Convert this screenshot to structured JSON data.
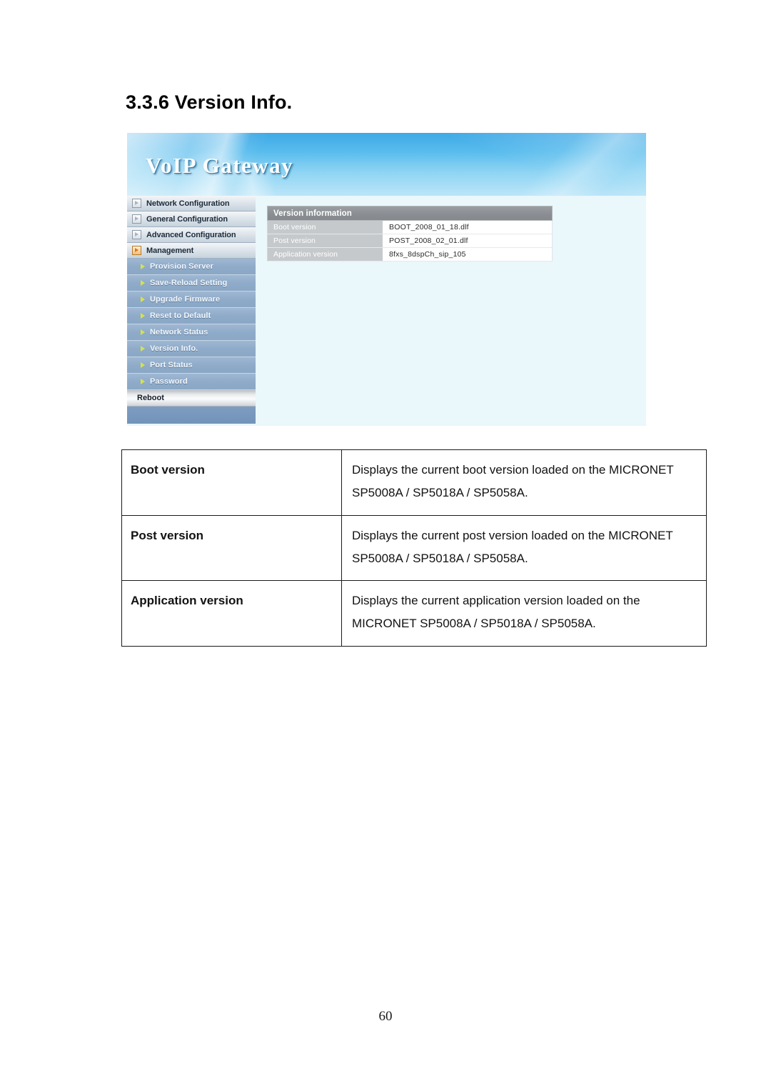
{
  "document": {
    "section_heading": "3.3.6 Version Info.",
    "page_number": "60"
  },
  "screenshot": {
    "banner_title": "VoIP Gateway",
    "sidebar": {
      "top_items": [
        {
          "label": "Network Configuration",
          "icon": "triangle-box-icon",
          "active": false
        },
        {
          "label": "General Configuration",
          "icon": "triangle-box-icon",
          "active": false
        },
        {
          "label": "Advanced Configuration",
          "icon": "triangle-box-icon",
          "active": false
        },
        {
          "label": "Management",
          "icon": "triangle-box-icon",
          "active": true
        }
      ],
      "sub_items": [
        {
          "label": "Provision Server",
          "icon": "arrow-right-icon"
        },
        {
          "label": "Save-Reload Setting",
          "icon": "arrow-right-icon"
        },
        {
          "label": "Upgrade Firmware",
          "icon": "arrow-right-icon"
        },
        {
          "label": "Reset to Default",
          "icon": "arrow-right-icon"
        },
        {
          "label": "Network Status",
          "icon": "arrow-right-icon"
        },
        {
          "label": "Version Info.",
          "icon": "arrow-right-icon"
        },
        {
          "label": "Port Status",
          "icon": "arrow-right-icon"
        },
        {
          "label": "Password",
          "icon": "arrow-right-icon"
        }
      ],
      "reboot_label": "Reboot"
    },
    "version_panel": {
      "title": "Version information",
      "rows": [
        {
          "label": "Boot version",
          "value": "BOOT_2008_01_18.dlf"
        },
        {
          "label": "Post version",
          "value": "POST_2008_02_01.dlf"
        },
        {
          "label": "Application version",
          "value": "8fxs_8dspCh_sip_105"
        }
      ]
    },
    "colors": {
      "banner_blue": "#59bced",
      "panel_background": "#eaf7fb",
      "panel_header_gray": "#8b8e92",
      "label_cell_gray": "#c6c9cc",
      "sub_item_blue": "#8fabc9",
      "sub_item_arrow_green": "#d6e24a",
      "active_icon_orange": "#e2761b"
    }
  },
  "description_table": {
    "rows": [
      {
        "term": "Boot version",
        "line1": "Displays the current boot version loaded on the MICRONET",
        "line2": "SP5008A / SP5018A / SP5058A."
      },
      {
        "term": "Post version",
        "line1": "Displays the current post version loaded on the MICRONET",
        "line2": "SP5008A / SP5018A / SP5058A."
      },
      {
        "term": "Application version",
        "line1": "Displays the current application version loaded on the",
        "line2": "MICRONET SP5008A / SP5018A / SP5058A."
      }
    ]
  }
}
